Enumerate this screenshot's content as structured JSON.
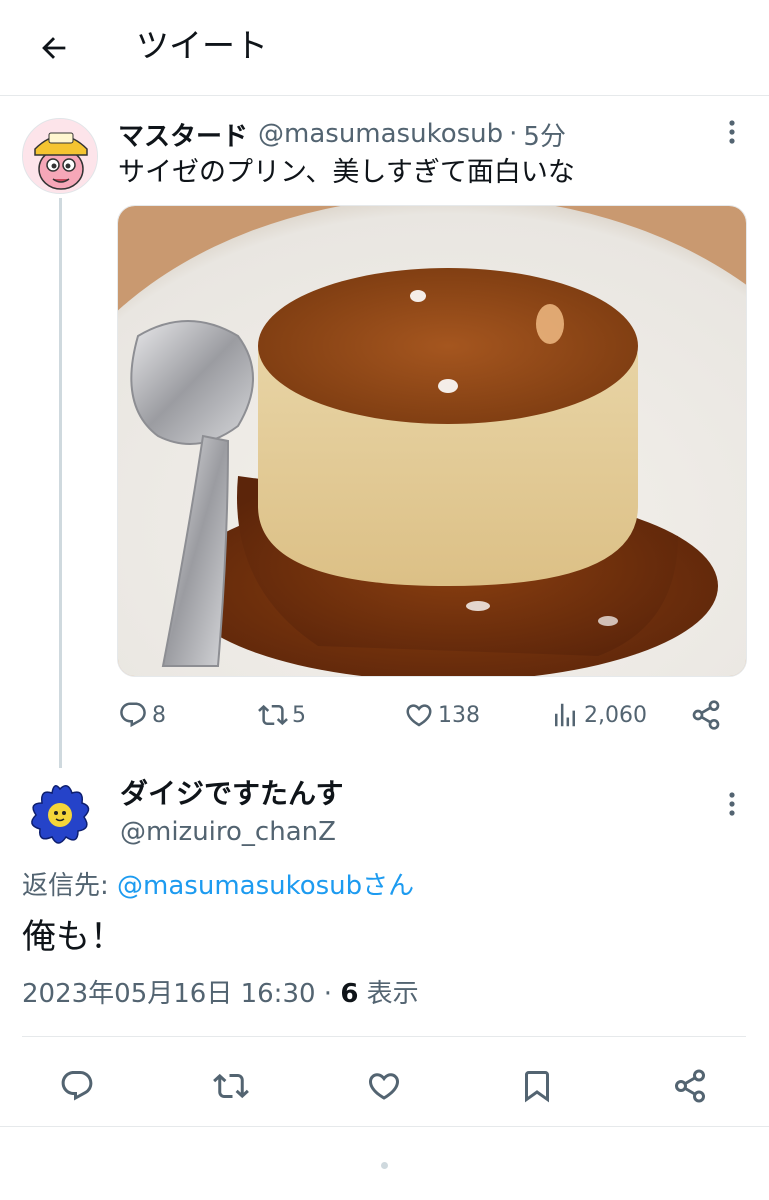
{
  "header": {
    "title": "ツイート",
    "back_icon": "back-arrow-icon"
  },
  "parent_tweet": {
    "author_name": "マスタード",
    "handle": "@masumasukosub",
    "separator": "·",
    "time": "5分",
    "text": "サイゼのプリン、美しすぎて面白いな",
    "media_description_icon": "pudding-photo",
    "stats": {
      "replies": "8",
      "retweets": "5",
      "likes": "138",
      "views": "2,060"
    }
  },
  "reply_tweet": {
    "author_name": "ダイジですたんす",
    "handle": "@mizuiro_chanZ",
    "reply_to_label": "返信先: ",
    "reply_to_mention": "@masumasukosubさん",
    "text": "俺も！",
    "timestamp": "2023年05月16日 16:30",
    "separator": " · ",
    "views_count": "6",
    "views_label": " 表示"
  },
  "colors": {
    "accent": "#1d9bf0",
    "text": "#0f1419",
    "secondary": "#536471",
    "divider": "#e6e9eb"
  }
}
